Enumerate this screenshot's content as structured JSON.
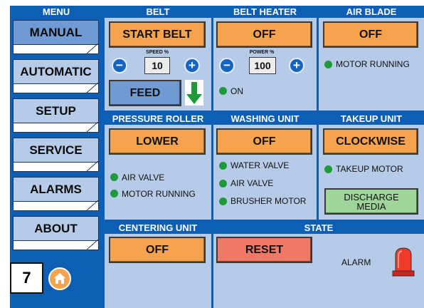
{
  "menu": {
    "title": "MENU",
    "items": [
      {
        "label": "MANUAL",
        "active": true
      },
      {
        "label": "AUTOMATIC",
        "active": false
      },
      {
        "label": "SETUP",
        "active": false
      },
      {
        "label": "SERVICE",
        "active": false
      },
      {
        "label": "ALARMS",
        "active": false
      },
      {
        "label": "ABOUT",
        "active": false
      }
    ]
  },
  "belt": {
    "title": "BELT",
    "start_label": "START BELT",
    "speed_label": "SPEED %",
    "speed_value": "10",
    "minus": "−",
    "plus": "+",
    "feed_label": "FEED"
  },
  "belt_heater": {
    "title": "BELT HEATER",
    "toggle_label": "OFF",
    "power_label": "POWER %",
    "power_value": "100",
    "minus": "−",
    "plus": "+",
    "status_on": "ON"
  },
  "air_blade": {
    "title": "AIR BLADE",
    "toggle_label": "OFF",
    "status_motor": "MOTOR RUNNING"
  },
  "pressure_roller": {
    "title": "PRESSURE ROLLER",
    "action_label": "LOWER",
    "status_air_valve": "AIR VALVE",
    "status_motor": "MOTOR RUNNING"
  },
  "washing_unit": {
    "title": "WASHING UNIT",
    "toggle_label": "OFF",
    "status_water_valve": "WATER VALVE",
    "status_air_valve": "AIR VALVE",
    "status_brusher": "BRUSHER MOTOR"
  },
  "takeup_unit": {
    "title": "TAKEUP UNIT",
    "direction_label": "CLOCKWISE",
    "status_motor": "TAKEUP MOTOR",
    "discharge_line1": "DISCHARGE",
    "discharge_line2": "MEDIA"
  },
  "centering_unit": {
    "title": "CENTERING UNIT",
    "toggle_label": "OFF"
  },
  "state": {
    "title": "STATE",
    "reset_label": "RESET",
    "alarm_label": "ALARM"
  },
  "screen_number": "7",
  "icons": {
    "home": "home-icon",
    "feed_arrow": "arrow-down-icon",
    "alarm_beacon": "alarm-beacon-icon"
  },
  "colors": {
    "frame_blue": "#0d5fb5",
    "panel_blue": "#b6cbe7",
    "button_orange": "#f6a34e",
    "button_red": "#f07a66",
    "button_green": "#9fd59a",
    "led_green": "#1f9a3a"
  }
}
